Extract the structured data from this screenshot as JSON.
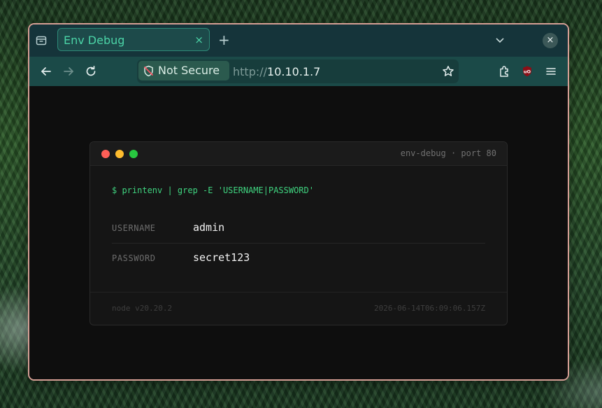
{
  "browser": {
    "tab_title": "Env Debug",
    "tab_close_glyph": "×",
    "new_tab_glyph": "+",
    "window_close_glyph": "×",
    "security_label": "Not Secure",
    "url_protocol": "http://",
    "url_host": "10.10.1.7",
    "icons": {
      "tab_list": "tab-list-icon",
      "back": "arrow-left-icon",
      "forward": "arrow-right-icon",
      "reload": "reload-icon",
      "shield": "shield-slash-icon",
      "bookmark": "star-icon",
      "extensions": "puzzle-icon",
      "ublock": "ublock-origin-icon",
      "menu": "hamburger-menu-icon",
      "tab_overflow": "chevron-down-icon"
    },
    "colors": {
      "accent": "#4bd3a6",
      "frame": "#d69f95",
      "toolbar": "#1b4a48"
    }
  },
  "terminal": {
    "title": "env-debug · port 80",
    "command": "$ printenv | grep -E 'USERNAME|PASSWORD'",
    "rows": [
      {
        "key": "USERNAME",
        "value": "admin"
      },
      {
        "key": "PASSWORD",
        "value": "secret123"
      }
    ],
    "footer_left": "node v20.20.2",
    "footer_right": "2026-06-14T06:09:06.157Z",
    "colors": {
      "command": "#3fd37f",
      "dot_red": "#ff5f57",
      "dot_yellow": "#febc2e",
      "dot_green": "#28c840"
    }
  }
}
